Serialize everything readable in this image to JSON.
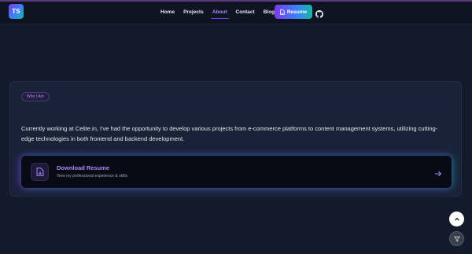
{
  "header": {
    "logo_text": "TS",
    "nav": [
      {
        "label": "Home",
        "active": false
      },
      {
        "label": "Projects",
        "active": false
      },
      {
        "label": "About",
        "active": true
      },
      {
        "label": "Contact",
        "active": false
      },
      {
        "label": "Blog",
        "active": false
      }
    ],
    "resume_label": "Resume",
    "github_icon": "github-icon"
  },
  "about": {
    "badge": "Who I Am",
    "description": "Currently working at Celite.in, I've had the opportunity to develop various projects from e-commerce platforms to content management systems, utilizing cutting-edge technologies in both frontend and backend development.",
    "download": {
      "title": "Download Resume",
      "subtitle": "View my professional experience & skills",
      "icon": "file-download-icon",
      "arrow_icon": "arrow-right-icon"
    }
  },
  "floating": {
    "scroll_top_icon": "chevron-up-icon",
    "filter_icon": "filter-icon"
  },
  "colors": {
    "background": "#131a2b",
    "card": "#1a2238",
    "accent_purple": "#7c3aed",
    "accent_teal": "#14b8a6",
    "link_purple": "#a78bfa"
  }
}
